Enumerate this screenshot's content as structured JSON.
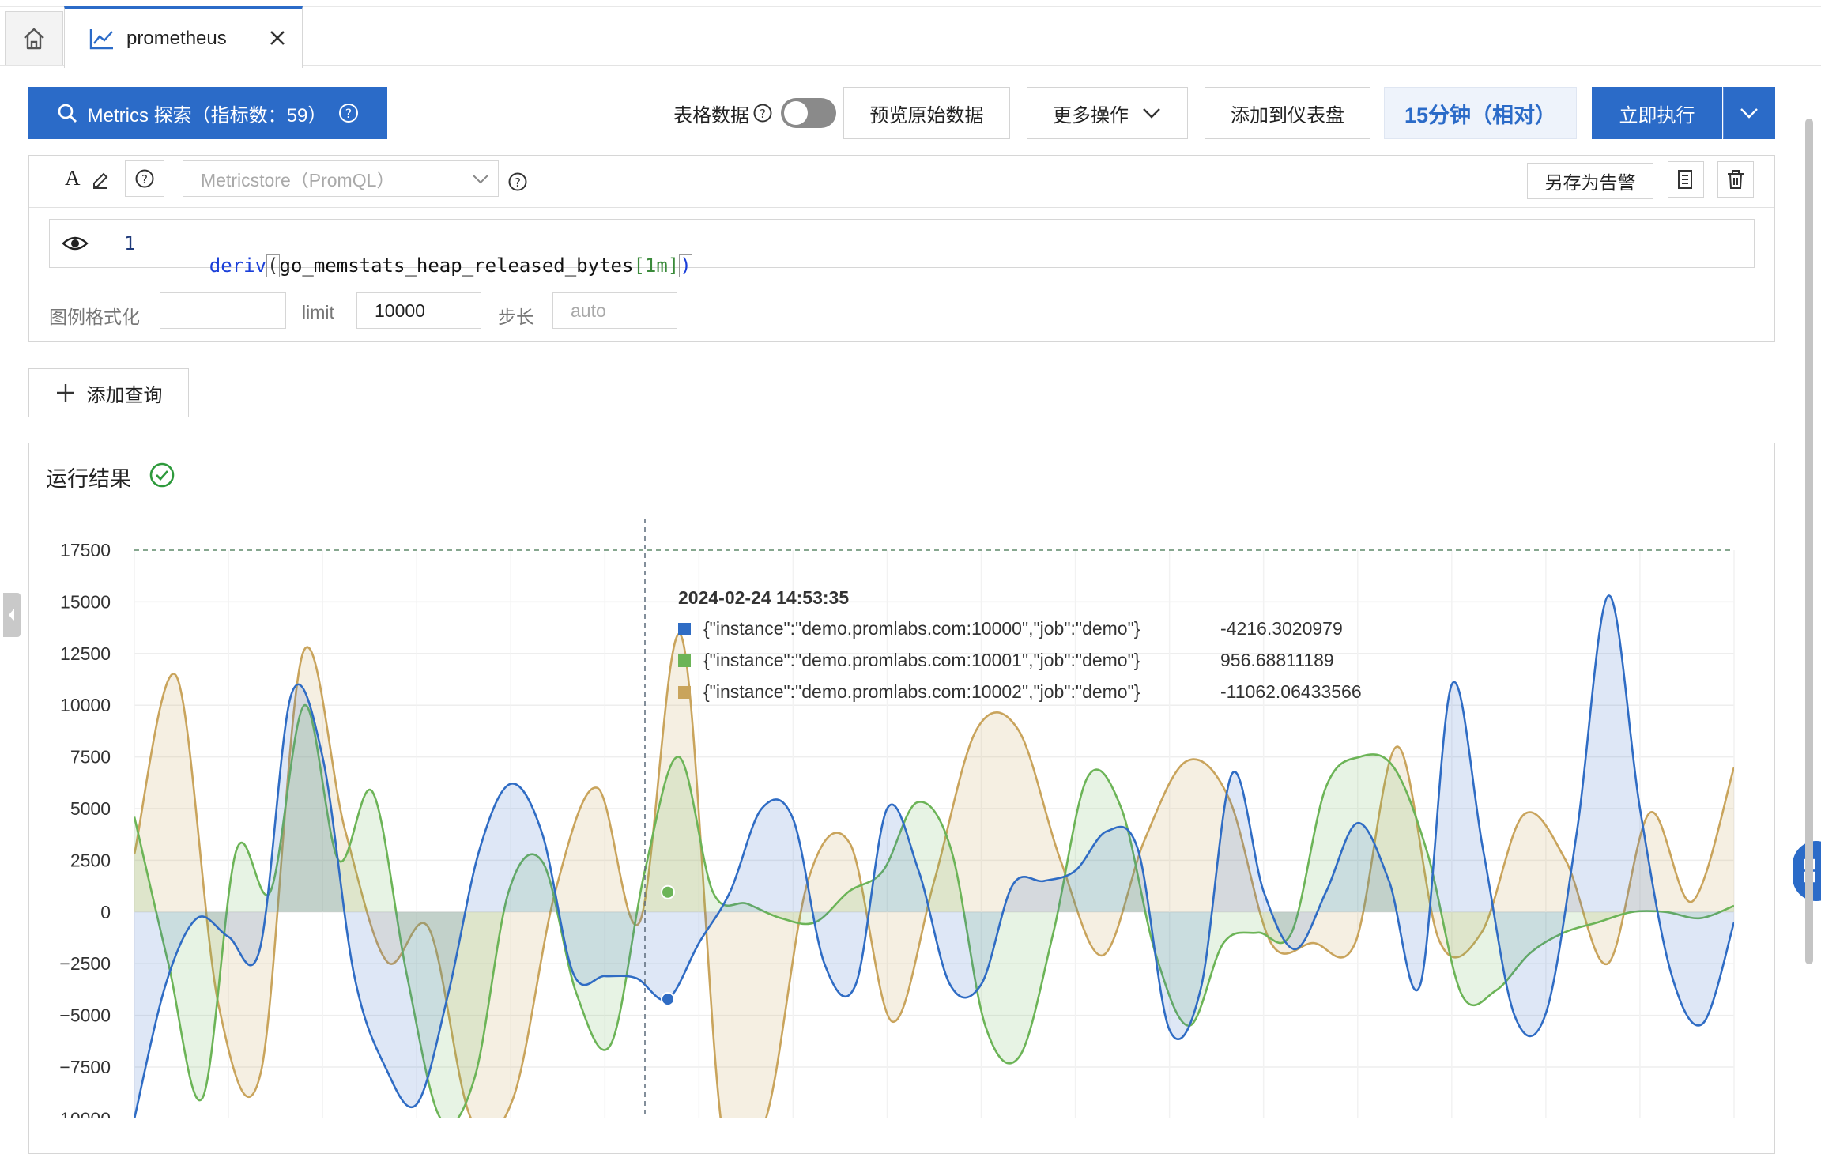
{
  "tabs": {
    "active_tab": "prometheus"
  },
  "toolbar": {
    "metrics_button": "Metrics 探索（指标数：59）",
    "table_data_label": "表格数据",
    "table_data_toggle": false,
    "preview_raw_button": "预览原始数据",
    "more_actions_button": "更多操作",
    "add_to_dashboard_button": "添加到仪表盘",
    "time_range_button": "15分钟（相对）",
    "execute_button": "立即执行"
  },
  "query": {
    "datasource_placeholder": "Metricstore（PromQL）",
    "save_as_alert_button": "另存为告警",
    "line_number": "1",
    "expr_func": "deriv",
    "expr_open": "(",
    "expr_metric": "go_memstats_heap_released_bytes",
    "expr_range": "[1m]",
    "expr_close": ")",
    "legend_format_label": "图例格式化",
    "legend_format_value": "",
    "limit_label": "limit",
    "limit_value": "10000",
    "step_label": "步长",
    "step_placeholder": "auto",
    "add_query_button": "添加查询"
  },
  "result": {
    "title": "运行结果"
  },
  "colors": {
    "accent": "#2b6bc8",
    "series_blue": "#2f6cc4",
    "series_green": "#6cb457",
    "series_gold": "#c9a45c",
    "success": "#2e9a3c"
  },
  "chart_data": {
    "type": "area",
    "y_ticks": [
      "17500",
      "15000",
      "12500",
      "10000",
      "7500",
      "5000",
      "2500",
      "0",
      "−2500",
      "−5000",
      "−7500",
      "−10000"
    ],
    "ylim": [
      -10000,
      17500
    ],
    "threshold_line": 17500,
    "grid": true,
    "series": [
      {
        "name": "{\"instance\":\"demo.promlabs.com:10000\",\"job\":\"demo\"}",
        "values": [
          -10000,
          -3500,
          -300,
          -1200,
          -1800,
          10500,
          7500,
          -3000,
          -7500,
          -9300,
          -4000,
          3000,
          6200,
          3800,
          -3000,
          -3100,
          -3200,
          -4216,
          -1500,
          1000,
          5000,
          4500,
          -2500,
          -3500,
          5000,
          2000,
          -3500,
          -3500,
          1300,
          1500,
          2000,
          3900,
          3000,
          -5700,
          -3700,
          6700,
          1000,
          -1800,
          1000,
          4300,
          1500,
          -3500,
          11000,
          3000,
          -5000,
          -4900,
          4000,
          15300,
          5000,
          -3000,
          -5400,
          -500
        ]
      },
      {
        "name": "{\"instance\":\"demo.promlabs.com:10001\",\"job\":\"demo\"}",
        "values": [
          4600,
          -2500,
          -9000,
          3000,
          1000,
          10000,
          2500,
          5800,
          -3000,
          -10000,
          -8000,
          1000,
          2400,
          -4000,
          -6400,
          2000,
          7500,
          957,
          400,
          -300,
          -500,
          1000,
          2000,
          5300,
          3000,
          -5500,
          -7000,
          -1000,
          6500,
          5000,
          -2000,
          -5500,
          -1500,
          -1000,
          -1000,
          6000,
          7500,
          7000,
          2800,
          -4000,
          -3800,
          -2000,
          -1000,
          -500,
          0,
          0,
          -300,
          300
        ],
        "note": ""
      },
      {
        "name": "{\"instance\":\"demo.promlabs.com:10002\",\"job\":\"demo\"}",
        "values": [
          2800,
          11400,
          -4500,
          -7800,
          12500,
          4000,
          -2400,
          -800,
          -10000,
          -9000,
          1000,
          6000,
          -500,
          13300,
          -11062,
          -10000,
          1500,
          3300,
          -5300,
          1500,
          8800,
          8800,
          2500,
          -2100,
          3500,
          7300,
          5500,
          -1500,
          -1500,
          -1500,
          8000,
          -1400,
          -1000,
          4700,
          2500,
          -2500,
          4800,
          500,
          7000
        ],
        "note": ""
      }
    ],
    "tooltip": {
      "time": "2024-02-24 14:53:35",
      "rows": [
        {
          "label": "{\"instance\":\"demo.promlabs.com:10000\",\"job\":\"demo\"}",
          "value": "-4216.3020979",
          "color": "#2f6cc4"
        },
        {
          "label": "{\"instance\":\"demo.promlabs.com:10001\",\"job\":\"demo\"}",
          "value": "956.68811189",
          "color": "#6cb457"
        },
        {
          "label": "{\"instance\":\"demo.promlabs.com:10002\",\"job\":\"demo\"}",
          "value": "-11062.06433566",
          "color": "#c9a45c"
        }
      ]
    }
  }
}
